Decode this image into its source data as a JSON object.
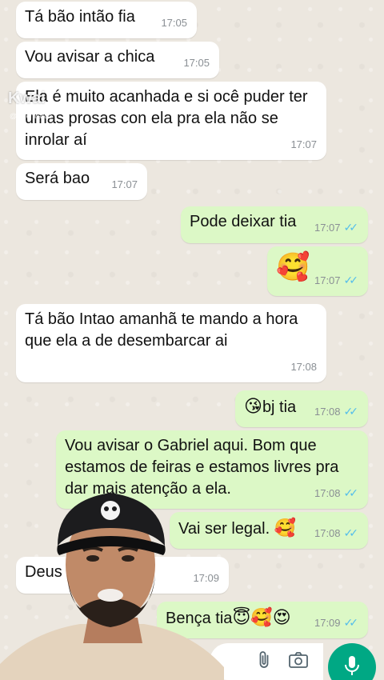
{
  "watermark": {
    "brand": "Kwai",
    "handle": "@akiemiaroo"
  },
  "messages": [
    {
      "text": "Tá bão intão fia",
      "time": "17:05"
    },
    {
      "text": "Vou avisar a chica",
      "time": "17:05"
    },
    {
      "text": "Ela é muito acanhada e si ocê puder ter umas prosas con ela pra ela não se inrolar aí",
      "time": "17:07"
    },
    {
      "text": "Será bao",
      "time": "17:07"
    },
    {
      "text": "Pode deixar tia",
      "time": "17:07",
      "ticks": "✓✓"
    },
    {
      "text": "🥰",
      "time": "17:07",
      "ticks": "✓✓"
    },
    {
      "text": "Tá bão Intao amanhã te mando a hora que ela a de desembarcar ai",
      "time": "17:08"
    },
    {
      "emoji": "😘",
      "text": "bj tia",
      "time": "17:08",
      "ticks": "✓✓"
    },
    {
      "text": "Vou avisar o Gabriel aqui. Bom que estamos de feiras e estamos livres pra dar mais atenção a ela.",
      "time": "17:08",
      "ticks": "✓✓"
    },
    {
      "text": "Vai ser legal. ",
      "emoji": "🥰",
      "time": "17:08",
      "ticks": "✓✓"
    },
    {
      "text": "Deus abençoe fia",
      "time": "17:09"
    },
    {
      "text": "Bença tia",
      "emoji": "😇🥰😍",
      "time": "17:09",
      "ticks": "✓✓"
    }
  ],
  "colors": {
    "incoming": "#ffffff",
    "outgoing": "#dcf8c6",
    "accent": "#00a884",
    "read_ticks": "#53bdeb"
  },
  "icons": [
    "paperclip-icon",
    "camera-icon",
    "microphone-icon"
  ]
}
